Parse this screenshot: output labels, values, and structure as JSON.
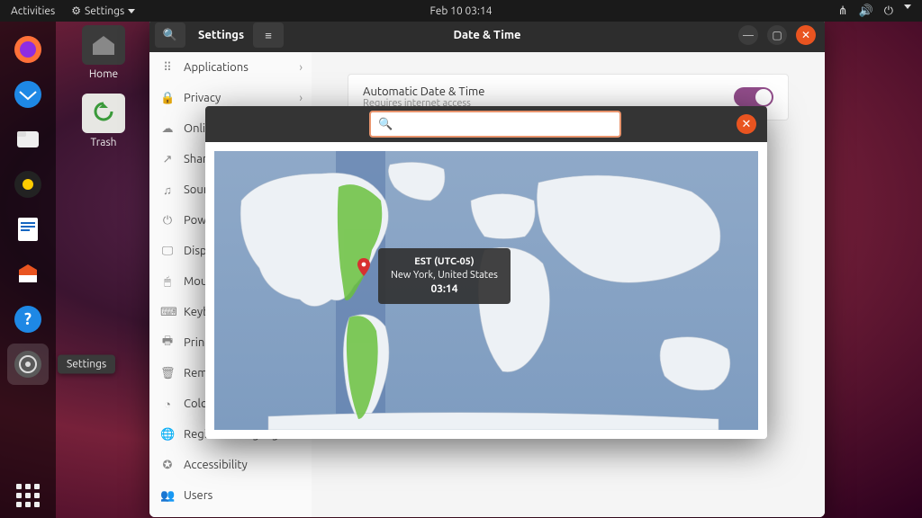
{
  "topbar": {
    "activities": "Activities",
    "appmenu": "Settings",
    "clock": "Feb 10  03:14"
  },
  "desktop": {
    "home": "Home",
    "trash": "Trash"
  },
  "dock": {
    "tooltip": "Settings"
  },
  "window": {
    "app_title": "Settings",
    "page_title": "Date & Time"
  },
  "sidebar": {
    "items": [
      {
        "icon": "⠿",
        "label": "Applications",
        "chev": true
      },
      {
        "icon": "🔒",
        "label": "Privacy",
        "chev": true
      },
      {
        "icon": "☁",
        "label": "Online Accounts"
      },
      {
        "icon": "↗",
        "label": "Sharing"
      },
      {
        "icon": "♫",
        "label": "Sound"
      },
      {
        "icon": "⏻",
        "label": "Power"
      },
      {
        "icon": "🖵",
        "label": "Displays"
      },
      {
        "icon": "🖱",
        "label": "Mouse & Touchpad"
      },
      {
        "icon": "⌨",
        "label": "Keyboard Shortcuts"
      },
      {
        "icon": "🖶",
        "label": "Printers"
      },
      {
        "icon": "🗑",
        "label": "Removable Media"
      },
      {
        "icon": "◔",
        "label": "Color"
      },
      {
        "icon": "🌐",
        "label": "Region & Language"
      },
      {
        "icon": "✪",
        "label": "Accessibility"
      },
      {
        "icon": "👥",
        "label": "Users"
      }
    ]
  },
  "content": {
    "auto_dt_label": "Automatic Date & Time",
    "auto_dt_sub": "Requires internet access"
  },
  "tz_modal": {
    "search_placeholder": "",
    "bubble_line1": "EST (UTC-05)",
    "bubble_line2": "New York, United States",
    "bubble_line3": "03:14"
  }
}
